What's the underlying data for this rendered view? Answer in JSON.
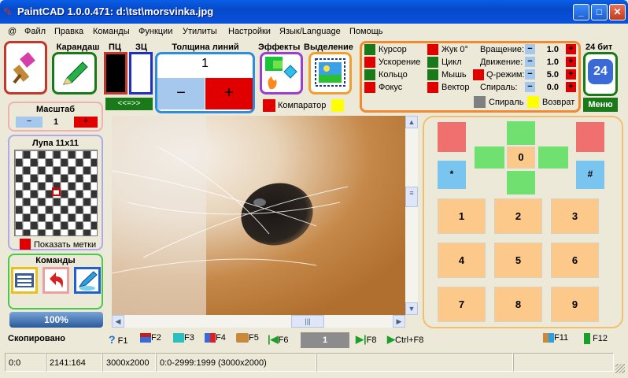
{
  "window": {
    "title": "PaintCAD 1.0.0.471: d:\\tst\\morsvinka.jpg"
  },
  "menu": [
    "@",
    "Файл",
    "Правка",
    "Команды",
    "Функции",
    "Утилиты",
    "Настройки",
    "Язык/Language",
    "Помощь"
  ],
  "toolbar": {
    "pencil_label": "Карандаш",
    "pc_label": "ПЦ",
    "zc_label": "ЗЦ",
    "swap_label": "<<=>>",
    "line_width_label": "Толщина линий",
    "line_width_value": "1",
    "minus": "−",
    "plus": "+",
    "effects_label": "Эффекты",
    "selection_label": "Выделение",
    "comparator_label": "Компаратор",
    "bits_label": "24 бит",
    "bits_value": "24",
    "menu_button": "Меню"
  },
  "options": {
    "col1": [
      "Курсор",
      "Ускорение",
      "Кольцо",
      "Фокус"
    ],
    "col2": [
      "Жук 0°",
      "Цикл",
      "Мышь",
      "Вектор"
    ],
    "params": [
      {
        "label": "Вращение:",
        "value": "1.0"
      },
      {
        "label": "Движение:",
        "value": "1.0"
      },
      {
        "label": "Q-режим:",
        "value": "5.0"
      },
      {
        "label": "Спираль:",
        "value": "0.0"
      }
    ],
    "spiral_label": "Спираль",
    "return_label": "Возврат",
    "colors": {
      "green": "#1a7a1a",
      "red": "#e00000",
      "gray": "#808080",
      "yellow": "#ffff00"
    }
  },
  "left": {
    "scale_label": "Масштаб",
    "scale_value": "1",
    "loupe_label": "Лупа 11x11",
    "show_marks_label": "Показать метки",
    "commands_label": "Команды",
    "progress_label": "100%"
  },
  "keypad": {
    "zero": "0",
    "star": "*",
    "hash": "#",
    "digits": [
      "1",
      "2",
      "3",
      "4",
      "5",
      "6",
      "7",
      "8",
      "9"
    ]
  },
  "fkeys": {
    "f1": "F1",
    "f2": "F2",
    "f3": "F3",
    "f4": "F4",
    "f5": "F5",
    "f6": "F6",
    "page_value": "1",
    "f8": "F8",
    "ctrl_f8": "Ctrl+F8",
    "f11": "F11",
    "f12": "F12"
  },
  "status": {
    "message": "Скопировано",
    "cells": [
      "0:0",
      "2141:164",
      "3000x2000",
      "0:0-2999:1999 (3000x2000)"
    ]
  }
}
